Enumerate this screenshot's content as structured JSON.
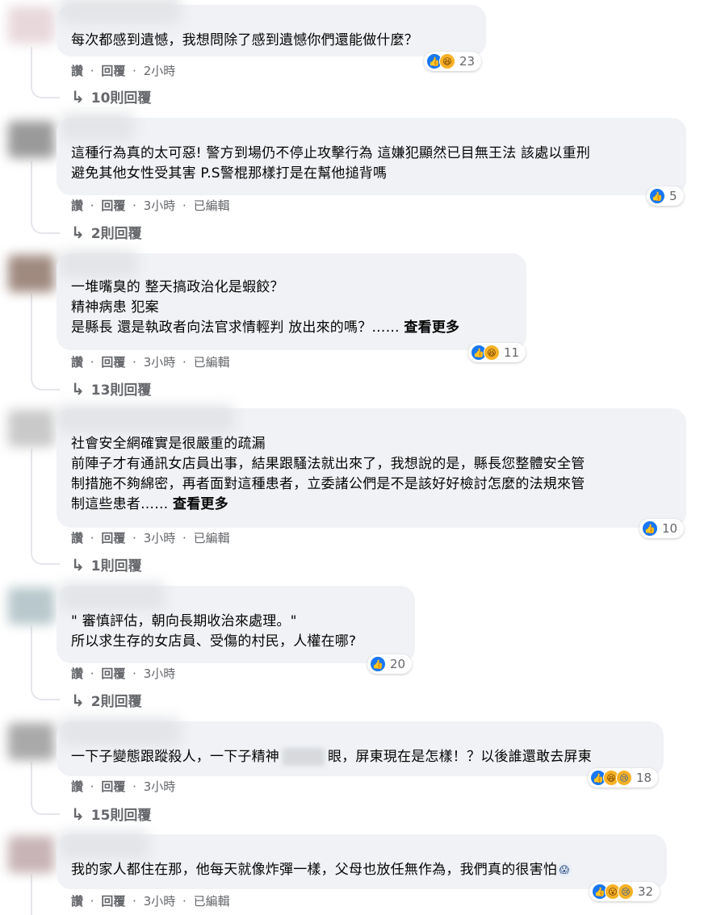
{
  "comments": [
    {
      "lines": [
        "每次都感到遺憾，我想問除了感到遺憾你們還能做什麼？"
      ],
      "see_more": "",
      "reactions": [
        "like-icon",
        "haha-icon"
      ],
      "reaction_count": "23",
      "actions": [
        "讚",
        "回覆"
      ],
      "time": "2小時",
      "edited": "",
      "replies": "10則回覆"
    },
    {
      "lines": [
        "這種行為真的太可惡! 警方到場仍不停止攻擊行為 這嫌犯顯然已目無王法 該處以重刑",
        "避免其他女性受其害 P.S警棍那樣打是在幫他搥背嗎"
      ],
      "see_more": "",
      "reactions": [
        "like-icon"
      ],
      "reaction_count": "5",
      "actions": [
        "讚",
        "回覆"
      ],
      "time": "3小時",
      "edited": "已編輯",
      "replies": "2則回覆"
    },
    {
      "lines": [
        "一堆嘴臭的 整天搞政治化是蝦餃？",
        "精神病患 犯案",
        "是縣長 還是執政者向法官求情輕判 放出來的嗎？……"
      ],
      "see_more": "查看更多",
      "reactions": [
        "like-icon",
        "haha-icon"
      ],
      "reaction_count": "11",
      "actions": [
        "讚",
        "回覆"
      ],
      "time": "3小時",
      "edited": "已編輯",
      "replies": "13則回覆"
    },
    {
      "lines": [
        "社會安全網確實是很嚴重的疏漏",
        "前陣子才有通訊女店員出事，結果跟騷法就出來了，我想說的是，縣長您整體安全管",
        "制措施不夠綿密，再者面對這種患者，立委諸公們是不是該好好檢討怎麼的法規來管",
        "制這些患者……"
      ],
      "see_more": "查看更多",
      "reactions": [
        "like-icon"
      ],
      "reaction_count": "10",
      "actions": [
        "讚",
        "回覆"
      ],
      "time": "3小時",
      "edited": "已編輯",
      "replies": "1則回覆"
    },
    {
      "lines": [
        "\" 審慎評估，朝向長期收治來處理。\"",
        "所以求生存的女店員、受傷的村民，人權在哪?"
      ],
      "see_more": "",
      "reactions": [
        "like-icon"
      ],
      "reaction_count": "20",
      "actions": [
        "讚",
        "回覆"
      ],
      "time": "3小時",
      "edited": "",
      "replies": "2則回覆"
    },
    {
      "text_before": "一下子變態跟蹤殺人，一下子精神",
      "text_after": "眼，屏東現在是怎樣！？以後誰還敢去屏東",
      "see_more": "",
      "reactions": [
        "like-icon",
        "haha-icon",
        "sad-icon"
      ],
      "reaction_count": "18",
      "actions": [
        "讚",
        "回覆"
      ],
      "time": "3小時",
      "edited": "",
      "replies": "15則回覆"
    },
    {
      "lines": [
        "我的家人都住在那，他每天就像炸彈一樣，父母也放任無作為，我們真的很害怕"
      ],
      "see_more": "",
      "reactions": [
        "like-icon",
        "wow-icon",
        "sad-icon"
      ],
      "reaction_count": "32",
      "actions": [
        "讚",
        "回覆"
      ],
      "time": "3小時",
      "edited": "已編輯",
      "replies": ""
    }
  ],
  "ui": {
    "separator": "·",
    "fear_emoji": "😱"
  },
  "colors": {
    "bubble": "#f0f2f5",
    "meta_text": "#65676b",
    "like_blue": "#1877f2"
  }
}
